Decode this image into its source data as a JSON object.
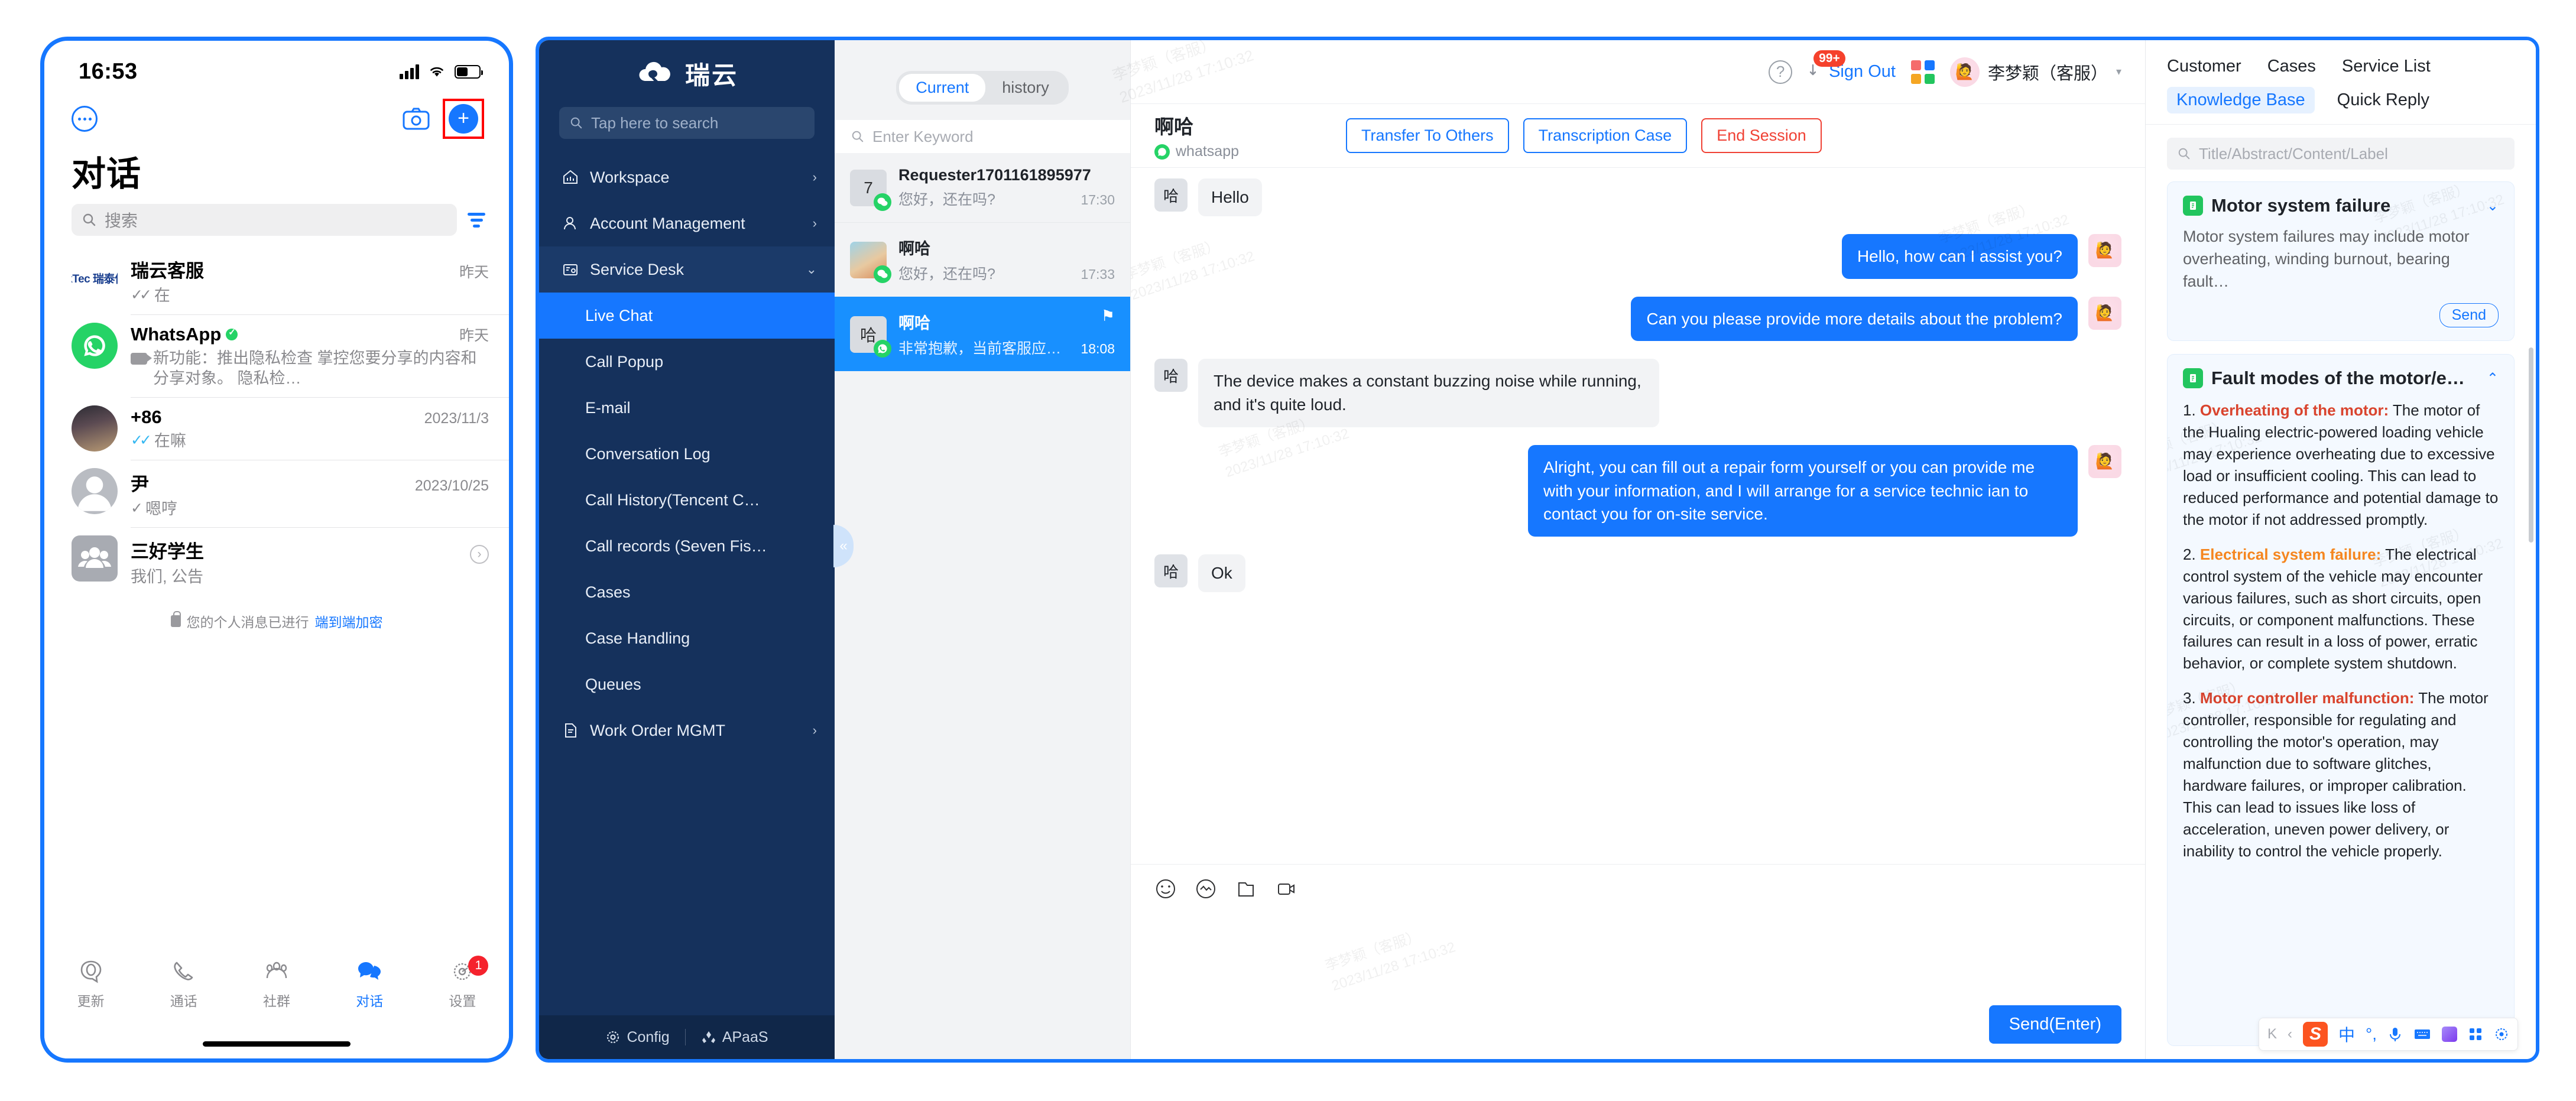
{
  "phone": {
    "status": {
      "time": "16:53"
    },
    "header": {
      "title": "对话"
    },
    "search": {
      "placeholder": "搜索"
    },
    "chats": [
      {
        "name": "瑞云客服",
        "time": "昨天",
        "ticks": "✓✓",
        "message": "在",
        "avatar_text": "RekTec 瑞泰信息",
        "avatar_type": "logo"
      },
      {
        "name": "WhatsApp",
        "time": "昨天",
        "verified": true,
        "message": "新功能：推出隐私检查   掌控您要分享的内容和分享对象。  隐私检…",
        "avatar_type": "whatsapp",
        "has_video_icon": true
      },
      {
        "name": "+86",
        "time": "2023/11/3",
        "ticks": "✓✓",
        "ticks_blue": true,
        "message": "在嘛",
        "avatar_type": "photo"
      },
      {
        "name": "尹",
        "time": "2023/10/25",
        "ticks": "✓",
        "message": "嗯哼",
        "avatar_type": "person"
      },
      {
        "name": "三好学生",
        "time": "",
        "message": "我们, 公告",
        "avatar_type": "group",
        "has_chevron": true
      }
    ],
    "encryption_notice": {
      "prefix": "您的个人消息已进行",
      "link": "端到端加密"
    },
    "tabs": [
      {
        "label": "更新",
        "icon": "updates-icon",
        "active": false
      },
      {
        "label": "通话",
        "icon": "phone-icon",
        "active": false
      },
      {
        "label": "社群",
        "icon": "communities-icon",
        "active": false
      },
      {
        "label": "对话",
        "icon": "chats-icon",
        "active": true
      },
      {
        "label": "设置",
        "icon": "settings-icon",
        "active": false,
        "badge": "1"
      }
    ]
  },
  "app": {
    "sidebar": {
      "brand": "瑞云",
      "search_placeholder": "Tap here to search",
      "items": [
        {
          "label": "Workspace",
          "icon": "home-icon",
          "arrow": "›",
          "type": "group"
        },
        {
          "label": "Account Management",
          "icon": "user-icon",
          "arrow": "›",
          "type": "group"
        },
        {
          "label": "Service Desk",
          "icon": "desk-icon",
          "arrow": "⌄",
          "type": "group",
          "open": true
        },
        {
          "label": "Live Chat",
          "type": "sub",
          "active": true
        },
        {
          "label": "Call Popup",
          "type": "sub"
        },
        {
          "label": "E-mail",
          "type": "sub"
        },
        {
          "label": "Conversation Log",
          "type": "sub"
        },
        {
          "label": "Call History(Tencent C…",
          "type": "sub"
        },
        {
          "label": "Call records (Seven Fis…",
          "type": "sub"
        },
        {
          "label": "Cases",
          "type": "sub"
        },
        {
          "label": "Case Handling",
          "type": "sub"
        },
        {
          "label": "Queues",
          "type": "sub"
        },
        {
          "label": "Work Order MGMT",
          "icon": "doc-icon",
          "arrow": "›",
          "type": "group"
        }
      ],
      "footer": {
        "config": "Config",
        "apaas": "APaaS"
      }
    },
    "conversations": {
      "tabs": [
        {
          "label": "Current",
          "active": true
        },
        {
          "label": "history",
          "active": false
        }
      ],
      "keyword_placeholder": "Enter Keyword",
      "items": [
        {
          "avatar": "7",
          "name": "Requester1701161895977",
          "message": "您好，还在吗?",
          "time": "17:30",
          "channel": "wechat",
          "selected": false
        },
        {
          "avatar": "",
          "name": "啊哈",
          "message": "您好，还在吗?",
          "time": "17:33",
          "channel": "wechat",
          "selected": false,
          "avatar_image": true
        },
        {
          "avatar": "哈",
          "name": "啊哈",
          "message": "非常抱歉，当前客服应接不暇…",
          "time": "18:08",
          "channel": "whatsapp",
          "selected": true,
          "flag": true
        }
      ]
    },
    "topbar": {
      "help": "?",
      "notification_badge": "99+",
      "sign_out": "Sign Out",
      "user_name": "李梦颖（客服）"
    },
    "chat_header": {
      "title": "啊哈",
      "channel": "whatsapp",
      "buttons": [
        {
          "label": "Transfer To Others",
          "style": "blue"
        },
        {
          "label": "Transcription Case",
          "style": "blue"
        },
        {
          "label": "End Session",
          "style": "red"
        }
      ]
    },
    "messages": [
      {
        "dir": "in",
        "avatar": "哈",
        "text": "Hello",
        "small": true
      },
      {
        "dir": "out",
        "avatar": "🙋",
        "text": "Hello, how can I assist you?"
      },
      {
        "dir": "out",
        "avatar": "🙋",
        "text": "Can you please provide more details about the problem?"
      },
      {
        "dir": "in",
        "avatar": "哈",
        "text": "The device makes a constant buzzing noise while running, and it's quite loud."
      },
      {
        "dir": "out",
        "avatar": "🙋",
        "text": "Alright, you can fill out a repair form yourself or you can provide me with your information, and I will arrange for a service technic ian to contact you for on-site service."
      },
      {
        "dir": "in",
        "avatar": "哈",
        "text": "Ok",
        "small": true
      }
    ],
    "composer": {
      "tools": [
        "emoji-icon",
        "sticker-icon",
        "folder-icon",
        "video-icon"
      ],
      "send_label": "Send(Enter)"
    },
    "right_panel": {
      "tabs_primary": [
        "Customer",
        "Cases",
        "Service List"
      ],
      "tabs_secondary": [
        {
          "label": "Knowledge Base",
          "active": true
        },
        {
          "label": "Quick Reply",
          "active": false
        }
      ],
      "search_placeholder": "Title/Abstract/Content/Label",
      "cards": [
        {
          "title": "Motor system failure",
          "abstract": "Motor system failures may include motor overheating, winding burnout, bearing fault…",
          "send_label": "Send",
          "expanded": false,
          "caret": "⌄"
        },
        {
          "title": "Fault modes of the motor/e…",
          "expanded": true,
          "caret": "⌃",
          "sections": [
            {
              "num": "1.",
              "heading": "Overheating of the motor:",
              "color": "red",
              "body": " The motor of the Hualing electric-powered loading vehicle may experience overheating due to excessive load or insufficient cooling. This can lead to reduced performance and potential damage to the motor if not addressed promptly."
            },
            {
              "num": "2.",
              "heading": "Electrical system failure:",
              "color": "orange",
              "body": " The electrical control system of the vehicle may encounter various failures, such as short circuits, open circuits, or component malfunctions. These failures can result in a loss of power, erratic behavior, or complete system shutdown."
            },
            {
              "num": "3.",
              "heading": "Motor controller malfunction:",
              "color": "red",
              "body": " The motor controller, responsible for regulating and controlling the motor's operation, may malfunction due to software glitches, hardware failures, or improper calibration. This can lead to issues like loss of acceleration, uneven power delivery, or inability to control the vehicle properly."
            }
          ]
        }
      ]
    },
    "ime": {
      "prev_all": "K",
      "prev": "‹",
      "logo": "S",
      "items": [
        "中",
        "°,",
        "mic-icon",
        "keyboard-icon",
        "skin-icon",
        "apps-icon",
        "settings-icon"
      ]
    },
    "watermark": {
      "name": "李梦颖（客服）",
      "timestamp": "2023/11/28 17:10:32"
    }
  }
}
